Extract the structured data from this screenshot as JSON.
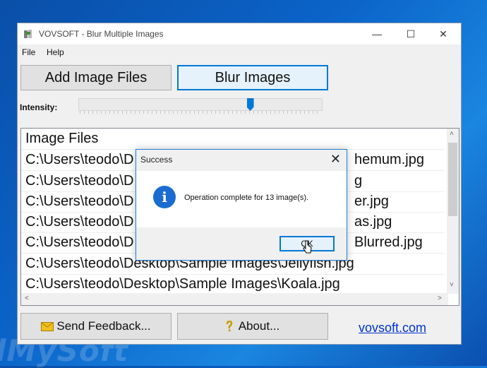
{
  "watermark": "lMySoft",
  "window": {
    "title": "VOVSOFT - Blur Multiple Images",
    "minimize": "—",
    "maximize": "☐",
    "close": "✕"
  },
  "menu": {
    "file": "File",
    "help": "Help"
  },
  "toolbar": {
    "add_label": "Add Image Files",
    "blur_label": "Blur Images"
  },
  "intensity": {
    "label": "Intensity:",
    "value_fraction": 0.71
  },
  "list": {
    "header": "Image Files",
    "rows": [
      "C:\\Users\\teodo\\D",
      "C:\\Users\\teodo\\D",
      "C:\\Users\\teodo\\D",
      "C:\\Users\\teodo\\D",
      "C:\\Users\\teodo\\D",
      "C:\\Users\\teodo\\Desktop\\Sample Images\\Jellyfish.jpg",
      "C:\\Users\\teodo\\Desktop\\Sample Images\\Koala.jpg"
    ],
    "row_tails": [
      "hemum.jpg",
      "g",
      "er.jpg",
      "as.jpg",
      "Blurred.jpg"
    ],
    "arrow_up": "˄",
    "arrow_down": "˅",
    "arrow_left": "<",
    "arrow_right": ">"
  },
  "footer": {
    "feedback_label": "Send Feedback...",
    "about_label": "About...",
    "link": "vovsoft.com"
  },
  "dialog": {
    "title": "Success",
    "close": "✕",
    "message": "Operation complete for 13 image(s).",
    "ok_label": "OK",
    "icon_glyph": "i"
  },
  "colors": {
    "accent": "#0078d7",
    "link": "#0033cc",
    "info": "#1a6dd0"
  }
}
